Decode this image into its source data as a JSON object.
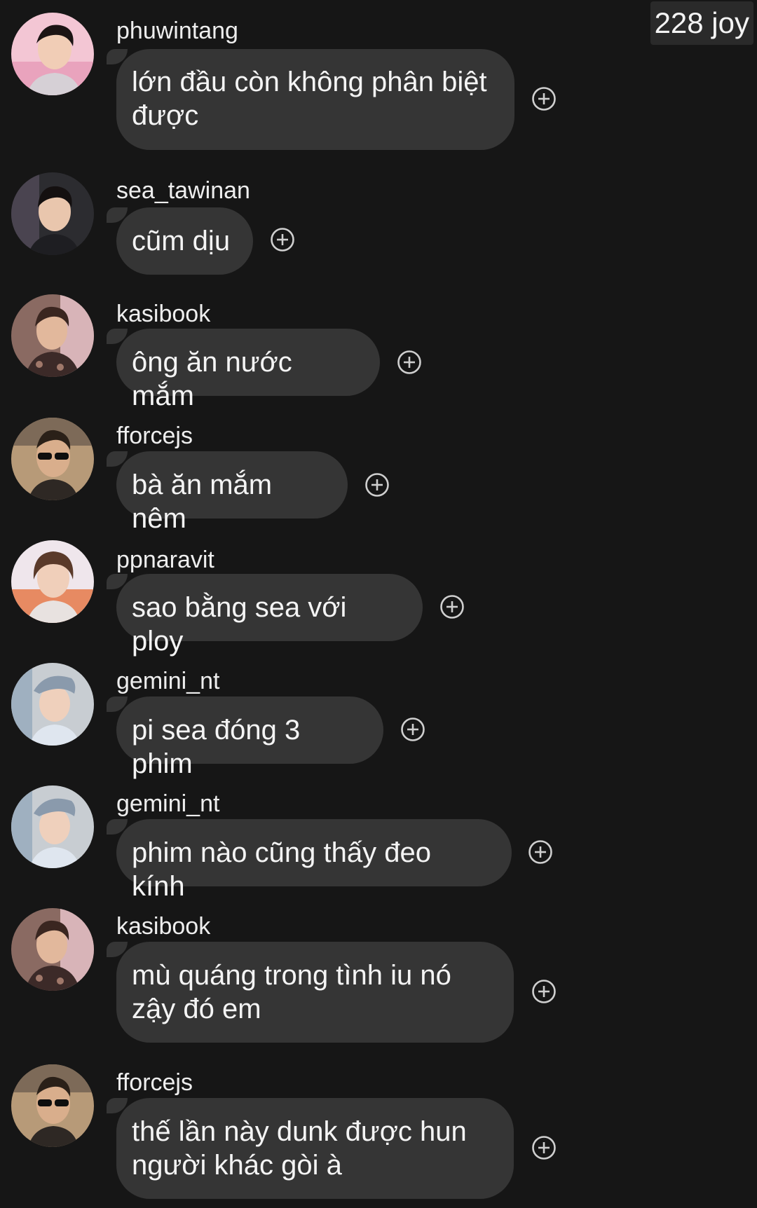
{
  "watermark": "228 joy",
  "colors": {
    "background": "#161616",
    "bubble": "#353535",
    "text": "#f2f2f2",
    "icon": "#cfcfcf"
  },
  "reaction_icon": "plus-circle-icon",
  "messages": [
    {
      "username": "phuwintang",
      "text": "lớn đầu còn không phân biệt được",
      "avatar": "profile-photo"
    },
    {
      "username": "sea_tawinan",
      "text": "cũm dịu",
      "avatar": "profile-photo"
    },
    {
      "username": "kasibook",
      "text": "ông ăn nước mắm",
      "avatar": "profile-photo"
    },
    {
      "username": "fforcejs",
      "text": "bà ăn mắm nêm",
      "avatar": "profile-photo"
    },
    {
      "username": "ppnaravit",
      "text": "sao bằng sea với ploy",
      "avatar": "profile-photo"
    },
    {
      "username": "gemini_nt",
      "text": "pi sea đóng 3 phim",
      "avatar": "profile-photo"
    },
    {
      "username": "gemini_nt",
      "text": "phim nào cũng thấy đeo kính",
      "avatar": "profile-photo"
    },
    {
      "username": "kasibook",
      "text": "mù quáng trong tình iu nó zậy đó em",
      "avatar": "profile-photo"
    },
    {
      "username": "fforcejs",
      "text": "thế lần này dunk được hun người khác gòi à",
      "avatar": "profile-photo"
    }
  ]
}
